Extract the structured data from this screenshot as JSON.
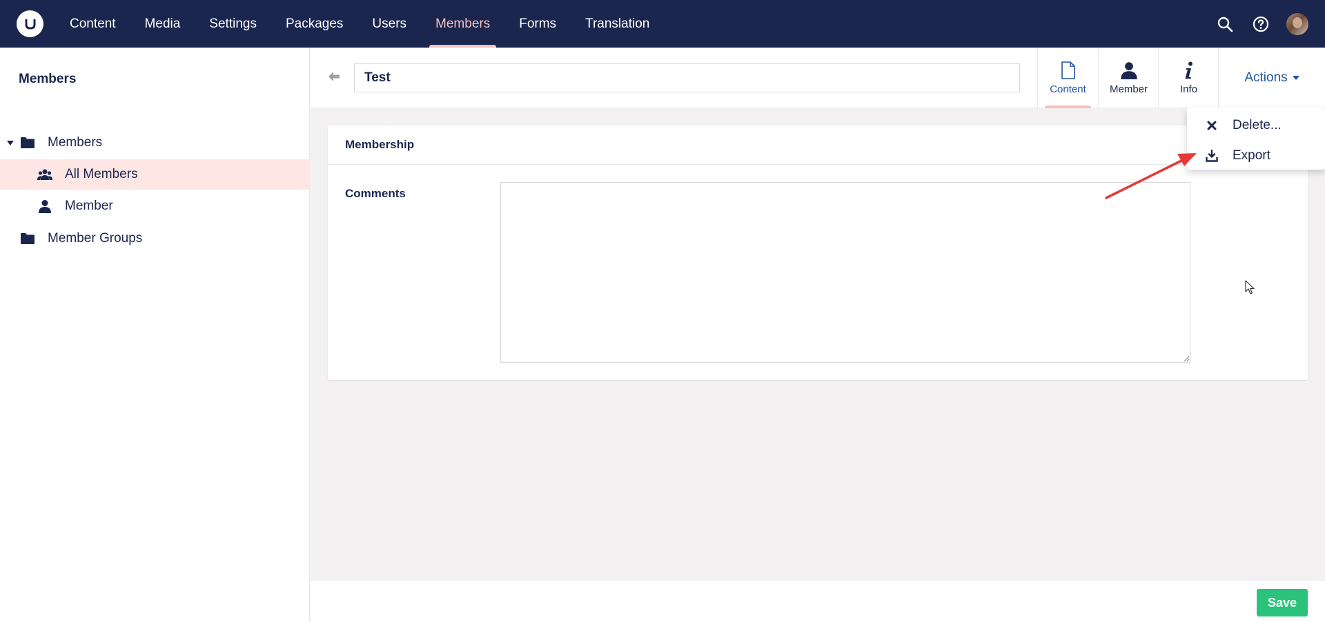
{
  "colors": {
    "topbar": "#1b264f",
    "accent": "#f5c1bc",
    "link": "#2152a3",
    "save": "#2bc37c",
    "selected": "#fde6e4"
  },
  "topnav": {
    "items": [
      {
        "label": "Content"
      },
      {
        "label": "Media"
      },
      {
        "label": "Settings"
      },
      {
        "label": "Packages"
      },
      {
        "label": "Users"
      },
      {
        "label": "Members",
        "active": true
      },
      {
        "label": "Forms"
      },
      {
        "label": "Translation"
      }
    ],
    "icons": [
      "search-icon",
      "help-icon",
      "avatar"
    ]
  },
  "sidebar": {
    "title": "Members",
    "tree": [
      {
        "label": "Members",
        "icon": "folder-icon",
        "expanded": true
      },
      {
        "label": "All Members",
        "icon": "users-icon",
        "selected": true
      },
      {
        "label": "Member",
        "icon": "user-icon"
      },
      {
        "label": "Member Groups",
        "icon": "folder-icon"
      }
    ]
  },
  "editor": {
    "name_value": "Test",
    "tabs": [
      {
        "label": "Content",
        "icon": "document-icon",
        "active": true
      },
      {
        "label": "Member",
        "icon": "user-icon"
      },
      {
        "label": "Info",
        "icon": "info-icon"
      }
    ],
    "actions_label": "Actions"
  },
  "actions_menu": {
    "items": [
      {
        "label": "Delete...",
        "icon": "close-icon"
      },
      {
        "label": "Export",
        "icon": "download-icon"
      }
    ]
  },
  "panel": {
    "title": "Membership",
    "property_label": "Comments",
    "comments_value": ""
  },
  "footer": {
    "save_label": "Save"
  }
}
